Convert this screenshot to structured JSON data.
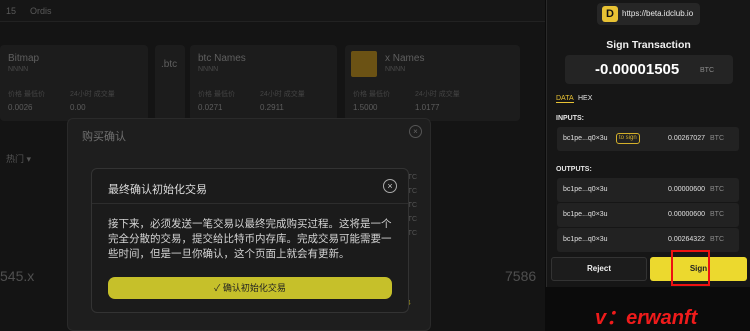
{
  "background": {
    "topbar_tabs": [
      "15",
      "Ordis"
    ],
    "cards": [
      {
        "name": "Bitmap",
        "sub": "NNNN",
        "stats": [
          "价格 最低价",
          "24小时 成交量"
        ],
        "vals": [
          "0.0026",
          "0.00"
        ]
      },
      {
        "name": "btc Names",
        "sub": "NNNN",
        "stats": [
          "价格 最低价",
          "24小时 成交量"
        ],
        "vals": [
          "0.0271",
          "0.2911"
        ]
      },
      {
        "name": "x Names",
        "sub": "NNNN",
        "stats": [
          "价格 最低价",
          "24小时 成交量"
        ],
        "vals": [
          "1.5000",
          "1.0177"
        ]
      }
    ],
    "btc_tile_label": ".btc",
    "filter_label": "热门 ▾",
    "big_left": "545.x",
    "big_right": "7586"
  },
  "buy_modal": {
    "title": "购买确认",
    "close": "×",
    "side_units": [
      "BTC",
      "BTC",
      "BTC",
      "BTC",
      "BTC"
    ],
    "side_yellow": [
      "64"
    ]
  },
  "init_modal": {
    "title": "最终确认初始化交易",
    "close": "×",
    "body": "接下来，必须发送一笔交易以最终完成购买过程。这将是一个完全分散的交易，提交给比特币内存库。完成交易可能需要一些时间，但是一旦你确认，这个页面上就会有更新。",
    "confirm_label": "✓ 确认初始化交易"
  },
  "wallet": {
    "logo_glyph": "D",
    "url": "https://beta.idclub.io",
    "title": "Sign Transaction",
    "amount": "-0.00001505",
    "amount_unit": "BTC",
    "tabs": {
      "data": "DATA",
      "hex": "HEX"
    },
    "inputs_label": "INPUTS:",
    "inputs": [
      {
        "addr": "bc1pe...q0×3u",
        "badge": "to sign",
        "value": "0.00267027",
        "unit": "BTC"
      }
    ],
    "outputs_label": "OUTPUTS:",
    "outputs": [
      {
        "addr": "bc1pe...q0×3u",
        "value": "0.00000600",
        "unit": "BTC"
      },
      {
        "addr": "bc1pe...q0×3u",
        "value": "0.00000600",
        "unit": "BTC"
      },
      {
        "addr": "bc1pe...q0×3u",
        "value": "0.00264322",
        "unit": "BTC"
      }
    ],
    "reject_label": "Reject",
    "sign_label": "Sign"
  },
  "watermark": "v：erwanft"
}
